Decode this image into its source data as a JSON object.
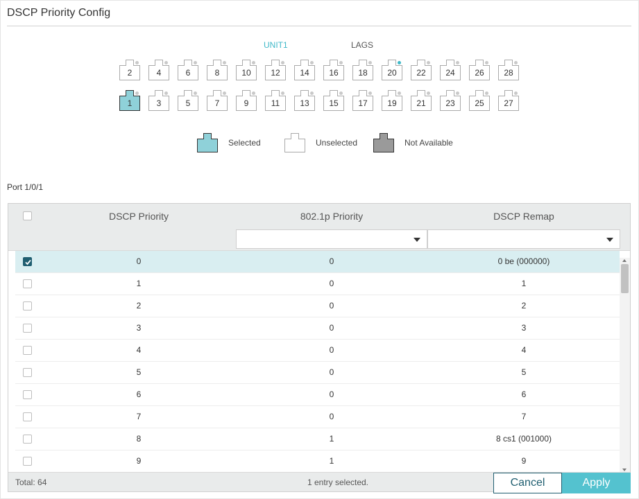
{
  "title": "DSCP Priority Config",
  "unit_tabs": [
    {
      "label": "UNIT1",
      "active": true
    },
    {
      "label": "LAGS",
      "active": false
    }
  ],
  "ports": {
    "row_even": [
      {
        "num": "2",
        "state": "unselected",
        "link": false
      },
      {
        "num": "4",
        "state": "unselected",
        "link": false
      },
      {
        "num": "6",
        "state": "unselected",
        "link": false
      },
      {
        "num": "8",
        "state": "unselected",
        "link": false
      },
      {
        "num": "10",
        "state": "unselected",
        "link": false
      },
      {
        "num": "12",
        "state": "unselected",
        "link": false
      },
      {
        "num": "14",
        "state": "unselected",
        "link": false
      },
      {
        "num": "16",
        "state": "unselected",
        "link": false
      },
      {
        "num": "18",
        "state": "unselected",
        "link": false
      },
      {
        "num": "20",
        "state": "unselected",
        "link": true
      },
      {
        "num": "22",
        "state": "unselected",
        "link": false
      },
      {
        "num": "24",
        "state": "unselected",
        "link": false
      },
      {
        "num": "26",
        "state": "unselected",
        "link": false
      },
      {
        "num": "28",
        "state": "unselected",
        "link": false
      }
    ],
    "row_odd": [
      {
        "num": "1",
        "state": "selected",
        "link": false
      },
      {
        "num": "3",
        "state": "unselected",
        "link": false
      },
      {
        "num": "5",
        "state": "unselected",
        "link": false
      },
      {
        "num": "7",
        "state": "unselected",
        "link": false
      },
      {
        "num": "9",
        "state": "unselected",
        "link": false
      },
      {
        "num": "11",
        "state": "unselected",
        "link": false
      },
      {
        "num": "13",
        "state": "unselected",
        "link": false
      },
      {
        "num": "15",
        "state": "unselected",
        "link": false
      },
      {
        "num": "17",
        "state": "unselected",
        "link": false
      },
      {
        "num": "19",
        "state": "unselected",
        "link": false
      },
      {
        "num": "21",
        "state": "unselected",
        "link": false
      },
      {
        "num": "23",
        "state": "unselected",
        "link": false
      },
      {
        "num": "25",
        "state": "unselected",
        "link": false
      },
      {
        "num": "27",
        "state": "unselected",
        "link": false
      }
    ]
  },
  "legend": {
    "selected": "Selected",
    "unselected": "Unselected",
    "not_available": "Not Available"
  },
  "colors": {
    "selected_port": "#8fd1d9",
    "not_available_port": "#9a9a9a",
    "accent": "#3fb8c8",
    "checkbox_checked": "#1f5e70"
  },
  "port_label": "Port 1/0/1",
  "table": {
    "columns": [
      "DSCP Priority",
      "802.1p Priority",
      "DSCP Remap"
    ],
    "filters": {
      "priority_8021p": "",
      "dscp_remap": ""
    },
    "rows": [
      {
        "dscp": "0",
        "p8021": "0",
        "remap": "0 be (000000)",
        "checked": true
      },
      {
        "dscp": "1",
        "p8021": "0",
        "remap": "1",
        "checked": false
      },
      {
        "dscp": "2",
        "p8021": "0",
        "remap": "2",
        "checked": false
      },
      {
        "dscp": "3",
        "p8021": "0",
        "remap": "3",
        "checked": false
      },
      {
        "dscp": "4",
        "p8021": "0",
        "remap": "4",
        "checked": false
      },
      {
        "dscp": "5",
        "p8021": "0",
        "remap": "5",
        "checked": false
      },
      {
        "dscp": "6",
        "p8021": "0",
        "remap": "6",
        "checked": false
      },
      {
        "dscp": "7",
        "p8021": "0",
        "remap": "7",
        "checked": false
      },
      {
        "dscp": "8",
        "p8021": "1",
        "remap": "8 cs1 (001000)",
        "checked": false
      },
      {
        "dscp": "9",
        "p8021": "1",
        "remap": "9",
        "checked": false
      }
    ],
    "total": "Total: 64",
    "selection_info": "1 entry selected."
  },
  "buttons": {
    "cancel": "Cancel",
    "apply": "Apply"
  }
}
